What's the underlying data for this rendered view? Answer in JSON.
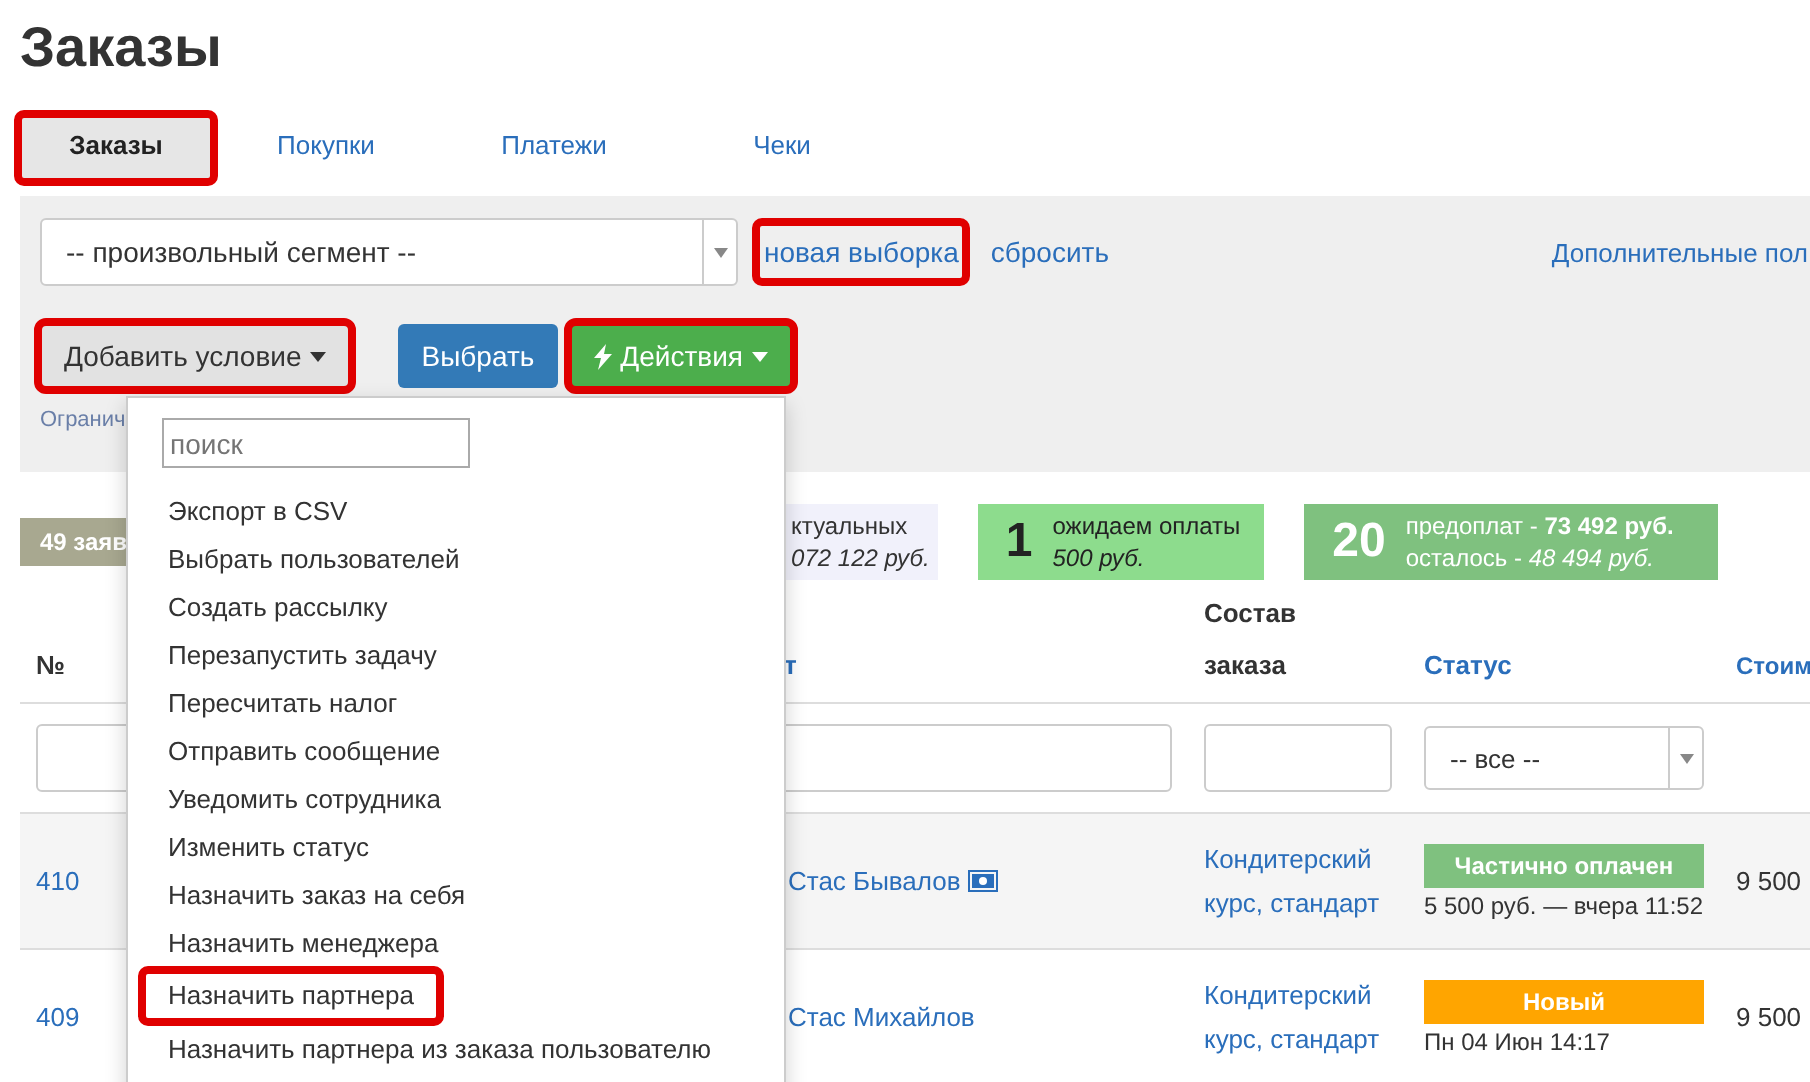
{
  "page_title": "Заказы",
  "tabs": [
    {
      "label": "Заказы",
      "selected": true,
      "highlighted": true
    },
    {
      "label": "Покупки",
      "selected": false,
      "highlighted": false
    },
    {
      "label": "Платежи",
      "selected": false,
      "highlighted": false
    },
    {
      "label": "Чеки",
      "selected": false,
      "highlighted": false
    }
  ],
  "filter": {
    "segment": "-- произвольный сегмент --",
    "new_selection": {
      "label": "новая выборка",
      "highlighted": true
    },
    "reset": "сбросить",
    "extra_fields": "Дополнительные пол",
    "add_condition": {
      "label": "Добавить условие",
      "highlighted": true
    },
    "choose": "Выбрать",
    "actions": {
      "label": "Действия",
      "highlighted": true
    },
    "limit_text": "Огранич"
  },
  "stats": [
    {
      "kind": "muted",
      "line1": "49 заяв"
    },
    {
      "kind": "light",
      "line1": "ктуальных",
      "line2": "072 122 руб."
    },
    {
      "kind": "green",
      "count": "1",
      "line1": "ожидаем оплаты",
      "line2": "500 руб."
    },
    {
      "kind": "dark",
      "count": "20",
      "line1": "предоплат - **73 492 руб.**",
      "line2": "осталось - *48 494 руб.*"
    }
  ],
  "table": {
    "columns": [
      {
        "label": "№",
        "link": false
      },
      {
        "label": "т",
        "link": true
      },
      {
        "label": "Состав заказа",
        "link": false
      },
      {
        "label": "Статус",
        "link": true
      },
      {
        "label": "Стоим",
        "link": true
      }
    ],
    "filters": [
      {
        "kind": "input"
      },
      {
        "kind": "input"
      },
      {
        "kind": "input"
      },
      {
        "kind": "select",
        "value": "-- все --"
      }
    ],
    "rows": [
      {
        "number": "410",
        "client": "Стас Бывалов",
        "client_icon": true,
        "items": "Кондитерский курс, стандарт",
        "status": "Частично оплачен",
        "color": "#7fc17f",
        "status_note": "5 500 руб. — вчера 11:52",
        "cost": "9 500"
      },
      {
        "number": "409",
        "client": "Стас Михайлов",
        "client_icon": false,
        "items": "Кондитерский курс, стандарт",
        "status": "Новый",
        "color": "#ffa500",
        "status_note": "Пн 04 Июн 14:17",
        "cost": "9 500"
      }
    ]
  },
  "actions_menu": {
    "search_placeholder": "поиск",
    "items": [
      {
        "label": "Экспорт в CSV",
        "highlighted": false
      },
      {
        "label": "Выбрать пользователей",
        "highlighted": false
      },
      {
        "label": "Создать рассылку",
        "highlighted": false
      },
      {
        "label": "Перезапустить задачу",
        "highlighted": false
      },
      {
        "label": "Пересчитать налог",
        "highlighted": false
      },
      {
        "label": "Отправить сообщение",
        "highlighted": false
      },
      {
        "label": "Уведомить сотрудника",
        "highlighted": false
      },
      {
        "label": "Изменить статус",
        "highlighted": false
      },
      {
        "label": "Назначить заказ на себя",
        "highlighted": false
      },
      {
        "label": "Назначить менеджера",
        "highlighted": false
      },
      {
        "label": "Назначить партнера",
        "highlighted": true
      },
      {
        "label": "Назначить партнера из заказа пользователю",
        "highlighted": false
      }
    ]
  }
}
